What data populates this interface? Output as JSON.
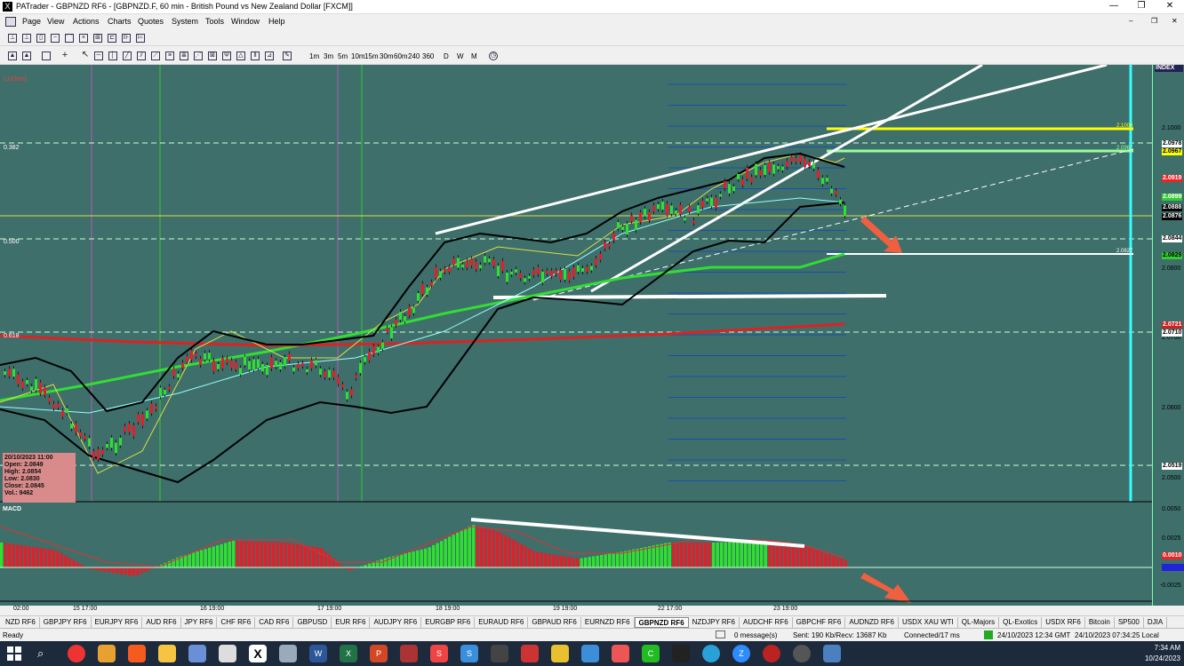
{
  "window": {
    "title": "PATrader - GBPNZD RF6 - [GBPNZD.F, 60 min - British Pound vs New Zealand Dollar [FXCM]]"
  },
  "menu": [
    "Page",
    "View",
    "Actions",
    "Charts",
    "Quotes",
    "System",
    "Tools",
    "Window",
    "Help"
  ],
  "timeframes": [
    "1m",
    "3m",
    "5m",
    "10m",
    "15m",
    "30m",
    "60m",
    "240",
    "360",
    "D",
    "W",
    "M"
  ],
  "chart": {
    "locked_label": "Locked",
    "fib_labels": [
      "0.382",
      "0.500",
      "0.618"
    ],
    "price_ticks": [
      "2.1000",
      "2.0900",
      "2.0800",
      "2.0700",
      "2.0600",
      "2.0500"
    ],
    "price_labels": [
      {
        "text": "2.0978",
        "color": "#ffffff"
      },
      {
        "text": "2.0967",
        "color": "#ffff00"
      },
      {
        "text": "2.0919",
        "color": "#ff3333"
      },
      {
        "text": "2.0899",
        "color": "#ffffff"
      },
      {
        "text": "2.0888",
        "color": "#000000"
      },
      {
        "text": "2.0876",
        "color": "#000000"
      },
      {
        "text": "2.0844",
        "color": "#ffffff"
      },
      {
        "text": "2.0829",
        "color": "#33cc33"
      },
      {
        "text": "2.0721",
        "color": "#cc2222"
      },
      {
        "text": "2.0710",
        "color": "#ffffff"
      },
      {
        "text": "2.0519",
        "color": "#ffffff"
      }
    ],
    "axis_header": "INDEX",
    "time_labels": [
      "02:00",
      "15 17:00",
      "16 19:00",
      "17 19:00",
      "18 19:00",
      "19 19:00",
      "22 17:00",
      "23 19:00"
    ],
    "macd_label": "MACD",
    "macd_ticks": [
      "0.0050",
      "0.0025",
      "-0.0025"
    ],
    "macd_value": "0.0010",
    "info": {
      "date": "20/10/2023 11:00",
      "open": "Open: 2.0849",
      "high": "High: 2.0854",
      "low": "Low: 2.0830",
      "close": "Close: 2.0845",
      "vol": "Vol.: 9462"
    }
  },
  "tabs": [
    "NZD RF6",
    "GBPJPY RF6",
    "EURJPY RF6",
    "AUD RF6",
    "JPY RF6",
    "CHF RF6",
    "CAD RF6",
    "GBPUSD",
    "EUR RF6",
    "AUDJPY RF6",
    "EURGBP RF6",
    "EURAUD RF6",
    "GBPAUD RF6",
    "EURNZD RF6",
    "GBPNZD RF6",
    "NZDJPY RF6",
    "AUDCHF RF6",
    "GBPCHF RF6",
    "AUDNZD RF6",
    "USDX XAU WTI",
    "QL-Majors",
    "QL-Exotics",
    "USDX RF6",
    "Bitcoin",
    "SP500",
    "DJIA"
  ],
  "active_tab": "GBPNZD RF6",
  "status": {
    "ready": "Ready",
    "messages": "0 message(s)",
    "traffic": "Sent: 190 Kb/Recv: 13687 Kb",
    "connection": "Connected/17 ms",
    "gmt": "24/10/2023 12:34 GMT",
    "local": "24/10/2023 07:34:25 Local"
  },
  "clock": {
    "time": "7:34 AM",
    "date": "10/24/2023"
  }
}
